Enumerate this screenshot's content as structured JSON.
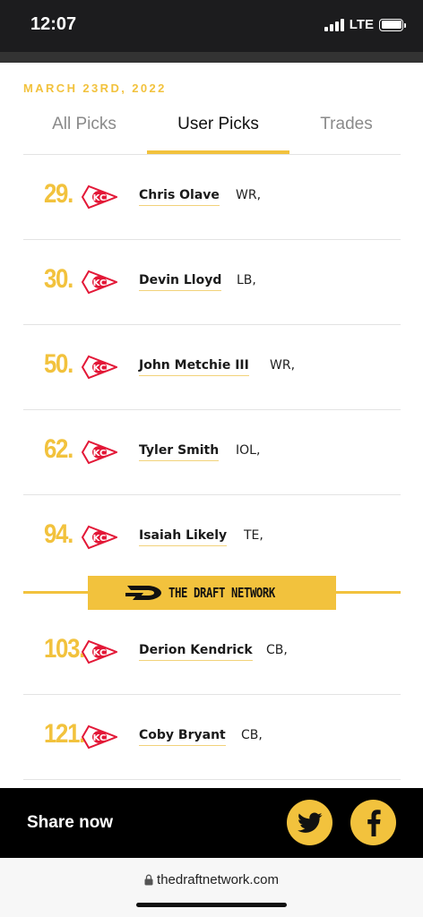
{
  "status_bar": {
    "time": "12:07",
    "network": "LTE"
  },
  "header": {
    "date": "MARCH 23RD, 2022"
  },
  "tabs": [
    {
      "label": "All Picks",
      "active": false
    },
    {
      "label": "User Picks",
      "active": true
    },
    {
      "label": "Trades",
      "active": false
    }
  ],
  "picks": [
    {
      "number": "29.",
      "team_icon": "chiefs-logo-icon",
      "player": "Chris Olave",
      "position": "WR,"
    },
    {
      "number": "30.",
      "team_icon": "chiefs-logo-icon",
      "player": "Devin Lloyd",
      "position": "LB,"
    },
    {
      "number": "50.",
      "team_icon": "chiefs-logo-icon",
      "player": "John Metchie III",
      "position": "WR,"
    },
    {
      "number": "62.",
      "team_icon": "chiefs-logo-icon",
      "player": "Tyler Smith",
      "position": "IOL,"
    },
    {
      "number": "94.",
      "team_icon": "chiefs-logo-icon",
      "player": "Isaiah Likely",
      "position": "TE,"
    },
    {
      "number": "103.",
      "team_icon": "chiefs-logo-icon",
      "player": "Derion Kendrick",
      "position": "CB,"
    },
    {
      "number": "121.",
      "team_icon": "chiefs-logo-icon",
      "player": "Coby Bryant",
      "position": "CB,"
    }
  ],
  "ad_banner": {
    "brand": "THE DRAFT NETWORK"
  },
  "share_bar": {
    "label": "Share now",
    "buttons": [
      "twitter-icon",
      "facebook-icon"
    ]
  },
  "browser": {
    "url": "thedraftnetwork.com"
  },
  "colors": {
    "accent": "#f2c23d",
    "chiefs_red": "#e31837",
    "dark": "#000000"
  }
}
